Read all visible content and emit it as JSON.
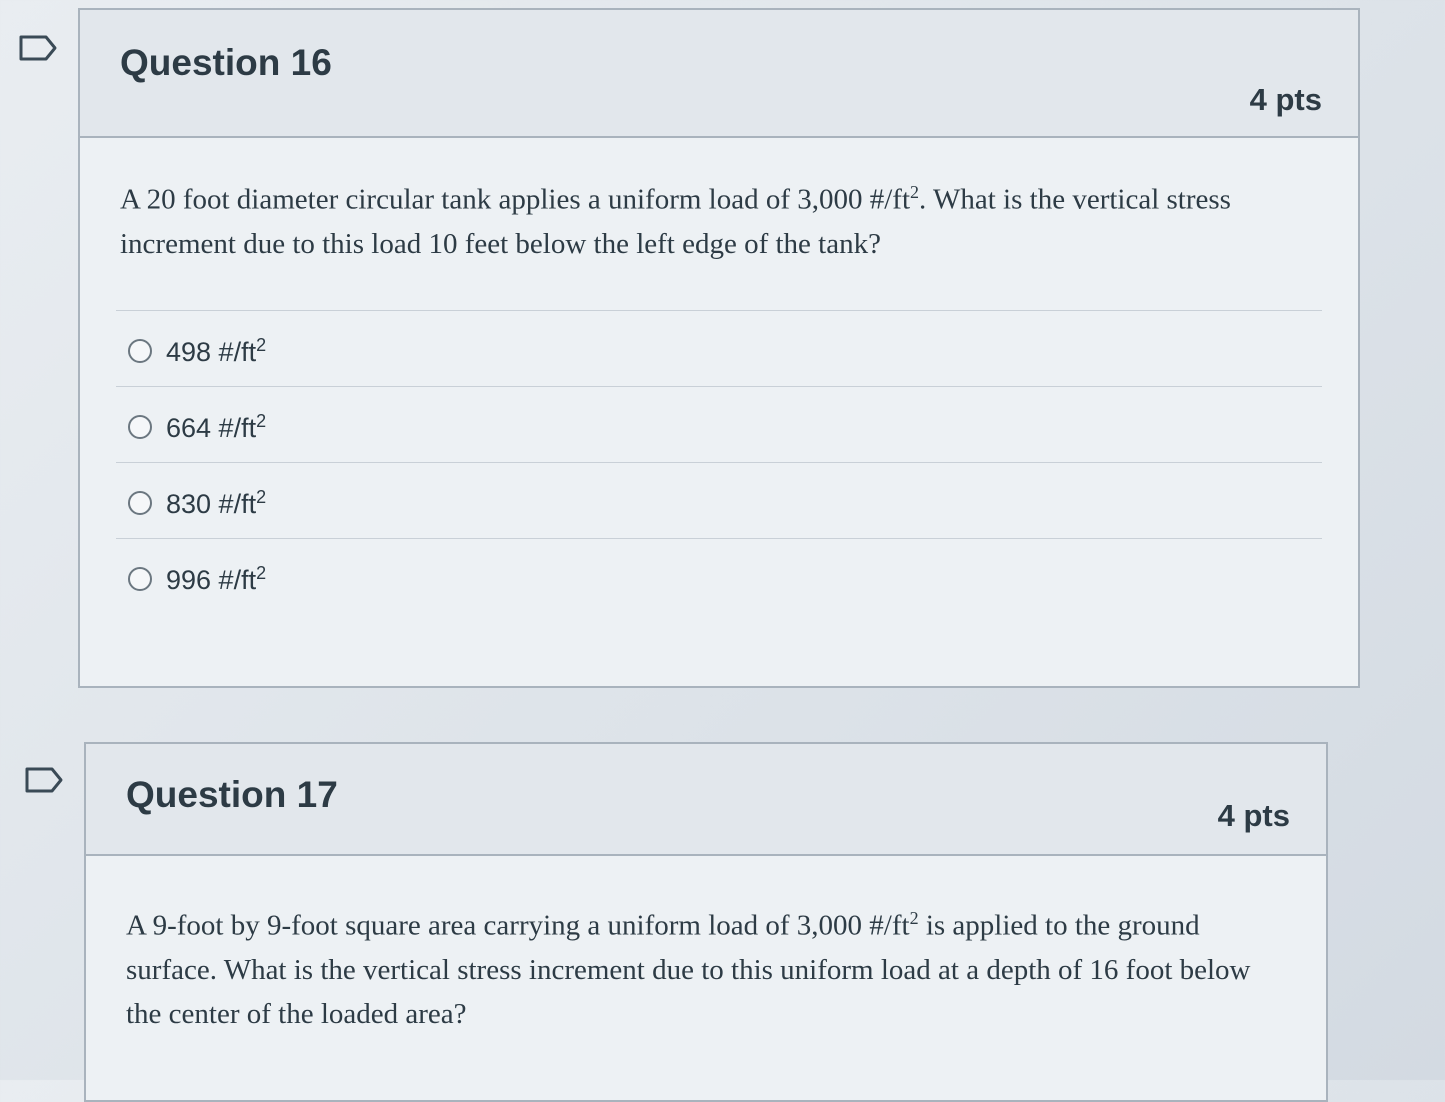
{
  "questions": [
    {
      "title": "Question 16",
      "points": "4 pts",
      "text_before_sup": "A 20 foot diameter circular tank applies a uniform load of 3,000 #/ft",
      "text_sup": "2",
      "text_after_sup": ". What is the vertical stress increment due to this load 10 feet below the left edge of the tank?",
      "answers": [
        {
          "value": "498 #/ft",
          "sup": "2"
        },
        {
          "value": "664 #/ft",
          "sup": "2"
        },
        {
          "value": "830 #/ft",
          "sup": "2"
        },
        {
          "value": "996 #/ft",
          "sup": "2"
        }
      ]
    },
    {
      "title": "Question 17",
      "points": "4 pts",
      "text_before_sup": "A 9-foot by 9-foot square area carrying a uniform load of 3,000 #/ft",
      "text_sup": "2",
      "text_after_sup": " is applied to the ground surface.  What is the vertical stress increment due to this uniform load at a depth of 16 foot below the center of the loaded area?"
    }
  ],
  "icons": {
    "flag": "flag-outline-icon",
    "radio": "radio-unchecked-icon"
  },
  "colors": {
    "text": "#2d3b45",
    "border": "#a9b3bd",
    "header_bg": "#e2e7ec",
    "body_bg": "#edf1f4"
  }
}
